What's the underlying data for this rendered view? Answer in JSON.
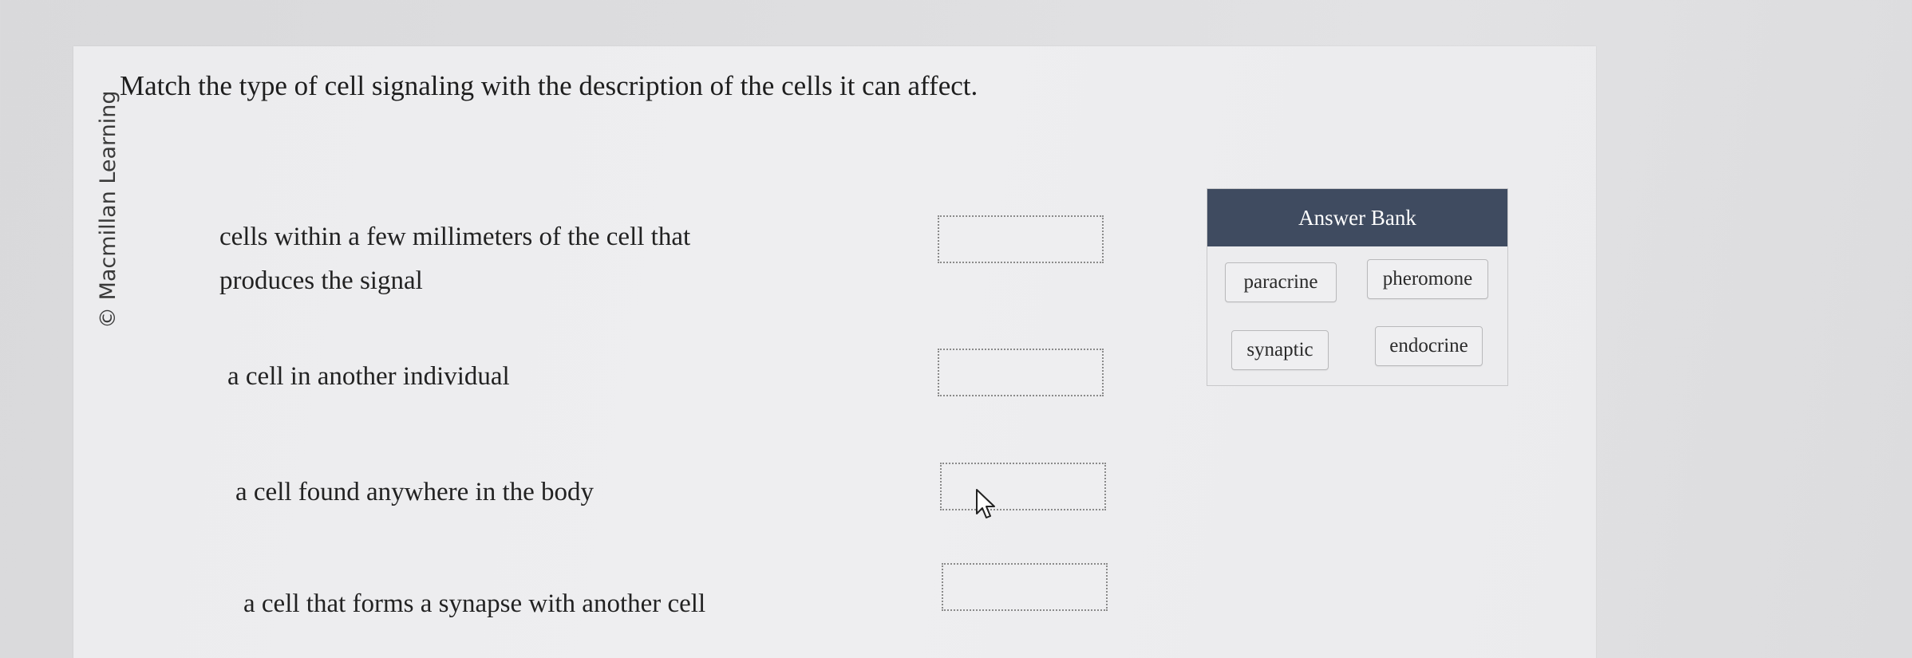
{
  "copyright": "© Macmillan Learning",
  "question": "Match the type of cell signaling with the description of the cells it can affect.",
  "prompts": [
    {
      "line1": "cells within a few millimeters of the cell that",
      "line2": "produces the signal"
    },
    {
      "text": "a cell in another individual"
    },
    {
      "text": "a cell found anywhere in the body"
    },
    {
      "text": "a cell that forms a synapse with another cell"
    }
  ],
  "answer_bank": {
    "title": "Answer Bank",
    "items": [
      "paracrine",
      "pheromone",
      "synaptic",
      "endocrine"
    ]
  },
  "colors": {
    "header_bg": "#3f4b60",
    "dropzone_border": "#8a8a8a"
  },
  "icons": {
    "cursor": "hand-pointer-cursor-icon"
  }
}
